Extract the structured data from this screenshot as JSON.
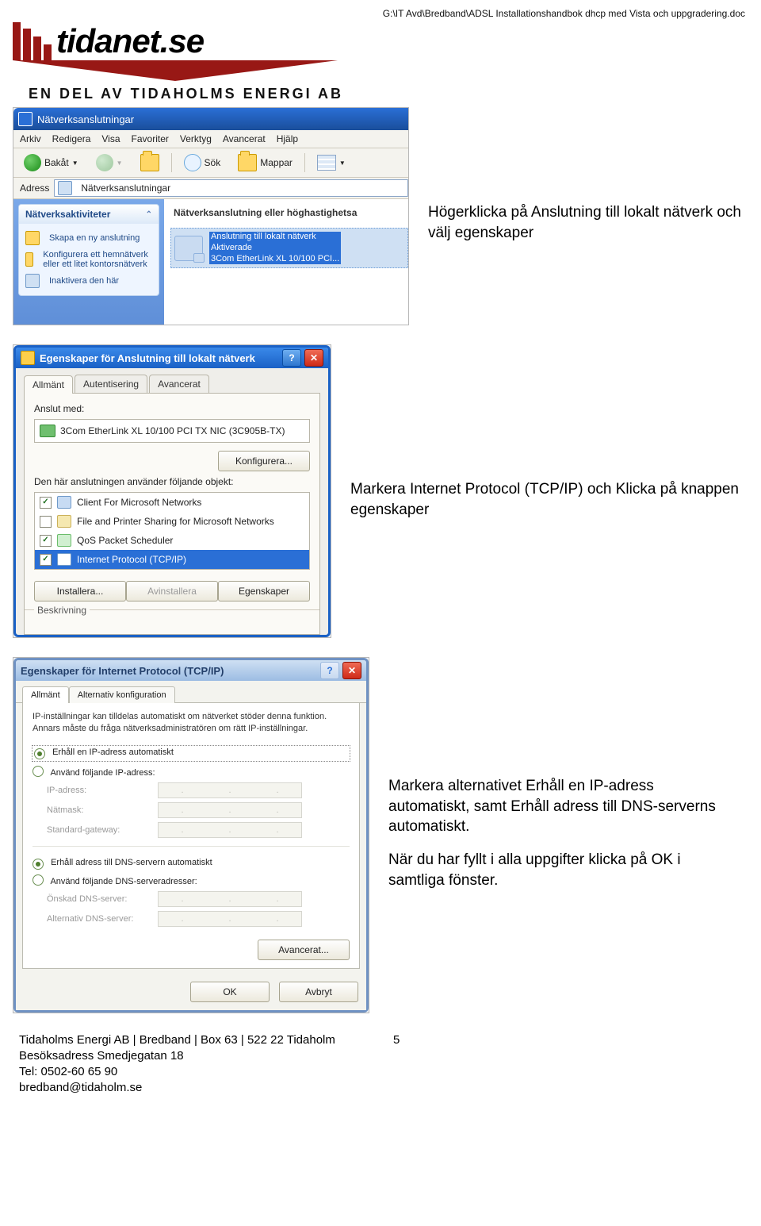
{
  "header": {
    "path": "G:\\IT Avd\\Bredband\\ADSL Installationshandbok dhcp med Vista och uppgradering.doc"
  },
  "logo": {
    "word": "tidanet.se",
    "sub": "EN DEL AV TIDAHOLMS ENERGI AB"
  },
  "annotation1": "Högerklicka på Anslutning till lokalt nätverk och välj egenskaper",
  "annotation2": "Markera Internet Protocol (TCP/IP) och Klicka på knappen egenskaper",
  "annotation3a": "Markera alternativet Erhåll en IP-adress automatiskt, samt Erhåll adress till DNS-serverns automatiskt.",
  "annotation3b": "När du har fyllt i alla uppgifter klicka på OK i samtliga fönster.",
  "s1": {
    "title": "Nätverksanslutningar",
    "menu": {
      "arkiv": "Arkiv",
      "redigera": "Redigera",
      "visa": "Visa",
      "favoriter": "Favoriter",
      "verktyg": "Verktyg",
      "avancerat": "Avancerat",
      "hjalp": "Hjälp"
    },
    "tb": {
      "bakat": "Bakåt",
      "sok": "Sök",
      "mappar": "Mappar"
    },
    "addr": {
      "label": "Adress",
      "value": "Nätverksanslutningar"
    },
    "sidepanel": {
      "title": "Nätverksaktiviteter",
      "items": [
        "Skapa en ny anslutning",
        "Konfigurera ett hemnätverk eller ett litet kontorsnätverk",
        "Inaktivera den här"
      ]
    },
    "main_header": "Nätverksanslutning eller höghastighetsa",
    "conn": {
      "l1": "Anslutning till lokalt nätverk",
      "l2": "Aktiverade",
      "l3": "3Com EtherLink XL 10/100 PCI..."
    }
  },
  "s2": {
    "title": "Egenskaper för Anslutning till lokalt nätverk",
    "tabs": {
      "allmant": "Allmänt",
      "autentisering": "Autentisering",
      "avancerat": "Avancerat"
    },
    "connect_with": "Anslut med:",
    "nic": "3Com EtherLink XL 10/100 PCI TX NIC (3C905B-TX)",
    "konfigurera": "Konfigurera...",
    "uses_objects": "Den här anslutningen använder följande objekt:",
    "items": {
      "client": "Client For Microsoft Networks",
      "fileprint": "File and Printer Sharing for Microsoft Networks",
      "qos": "QoS Packet Scheduler",
      "tcpip": "Internet Protocol (TCP/IP)"
    },
    "buttons": {
      "installera": "Installera...",
      "avinstallera": "Avinstallera",
      "egenskaper": "Egenskaper"
    },
    "beskrivning": "Beskrivning"
  },
  "s3": {
    "title": "Egenskaper för Internet Protocol (TCP/IP)",
    "tabs": {
      "allmant": "Allmänt",
      "altconf": "Alternativ konfiguration"
    },
    "desc": "IP-inställningar kan tilldelas automatiskt om nätverket stöder denna funktion. Annars måste du fråga nätverksadministratören om rätt IP-inställningar.",
    "radios": {
      "auto_ip": "Erhåll en IP-adress automatiskt",
      "manual_ip": "Använd följande IP-adress:",
      "auto_dns": "Erhåll adress till DNS-servern automatiskt",
      "manual_dns": "Använd följande DNS-serveradresser:"
    },
    "fields": {
      "ip": "IP-adress:",
      "mask": "Nätmask:",
      "gw": "Standard-gateway:",
      "dns1": "Önskad DNS-server:",
      "dns2": "Alternativ DNS-server:"
    },
    "buttons": {
      "avancerat": "Avancerat...",
      "ok": "OK",
      "avbryt": "Avbryt"
    }
  },
  "footer": {
    "l1": "Tidaholms Energi AB | Bredband | Box 63 | 522 22 Tidaholm",
    "l2": "Besöksadress Smedjegatan 18",
    "l3": "Tel: 0502-60 65 90",
    "l4": "bredband@tidaholm.se",
    "page_num": "5"
  }
}
